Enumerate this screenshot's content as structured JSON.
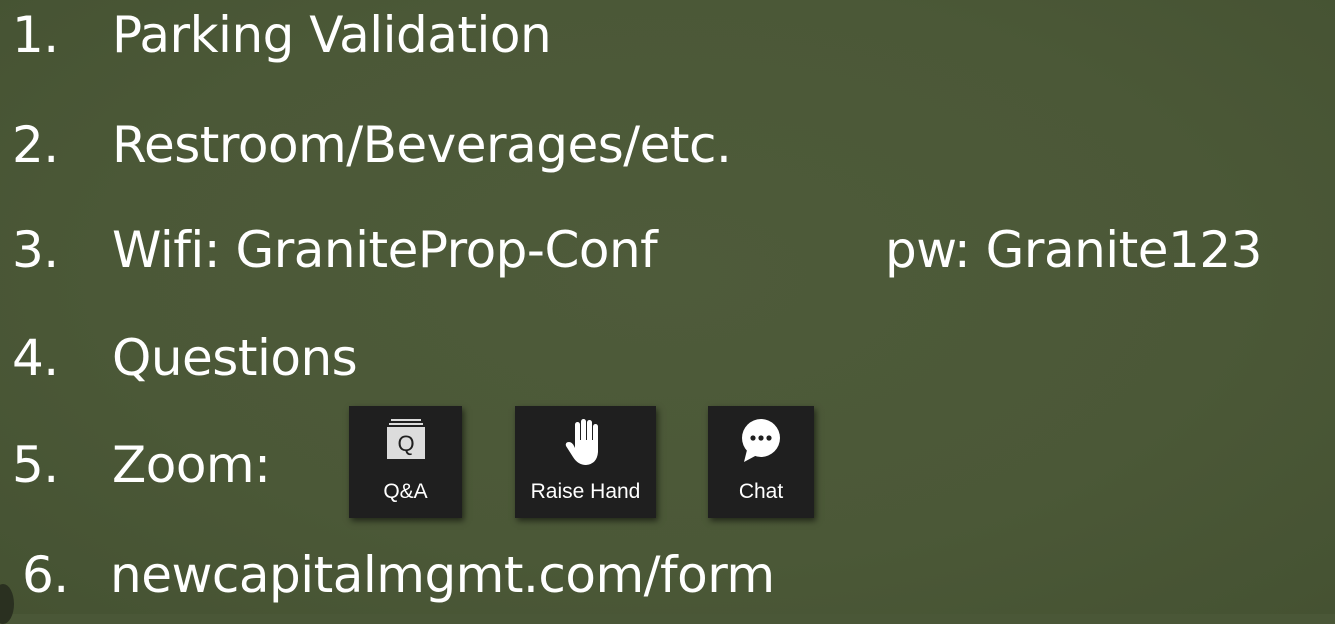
{
  "items": [
    {
      "num": "1.",
      "text": "Parking Validation"
    },
    {
      "num": "2.",
      "text": "Restroom/Beverages/etc."
    },
    {
      "num": "3.",
      "text": "Wifi: GraniteProp-Conf",
      "extra": "pw: Granite123"
    },
    {
      "num": "4.",
      "text": "Questions"
    },
    {
      "num": "5.",
      "text": "Zoom:"
    },
    {
      "num": "6.",
      "text": "newcapitalmgmt.com/form"
    }
  ],
  "zoom_buttons": {
    "qa": {
      "label": "Q&A",
      "icon": "qa-icon"
    },
    "raise_hand": {
      "label": "Raise Hand",
      "icon": "raise-hand-icon"
    },
    "chat": {
      "label": "Chat",
      "icon": "chat-icon"
    }
  },
  "colors": {
    "background": "#4a5737",
    "text": "#ffffff",
    "button_background": "#1f1f1f"
  }
}
